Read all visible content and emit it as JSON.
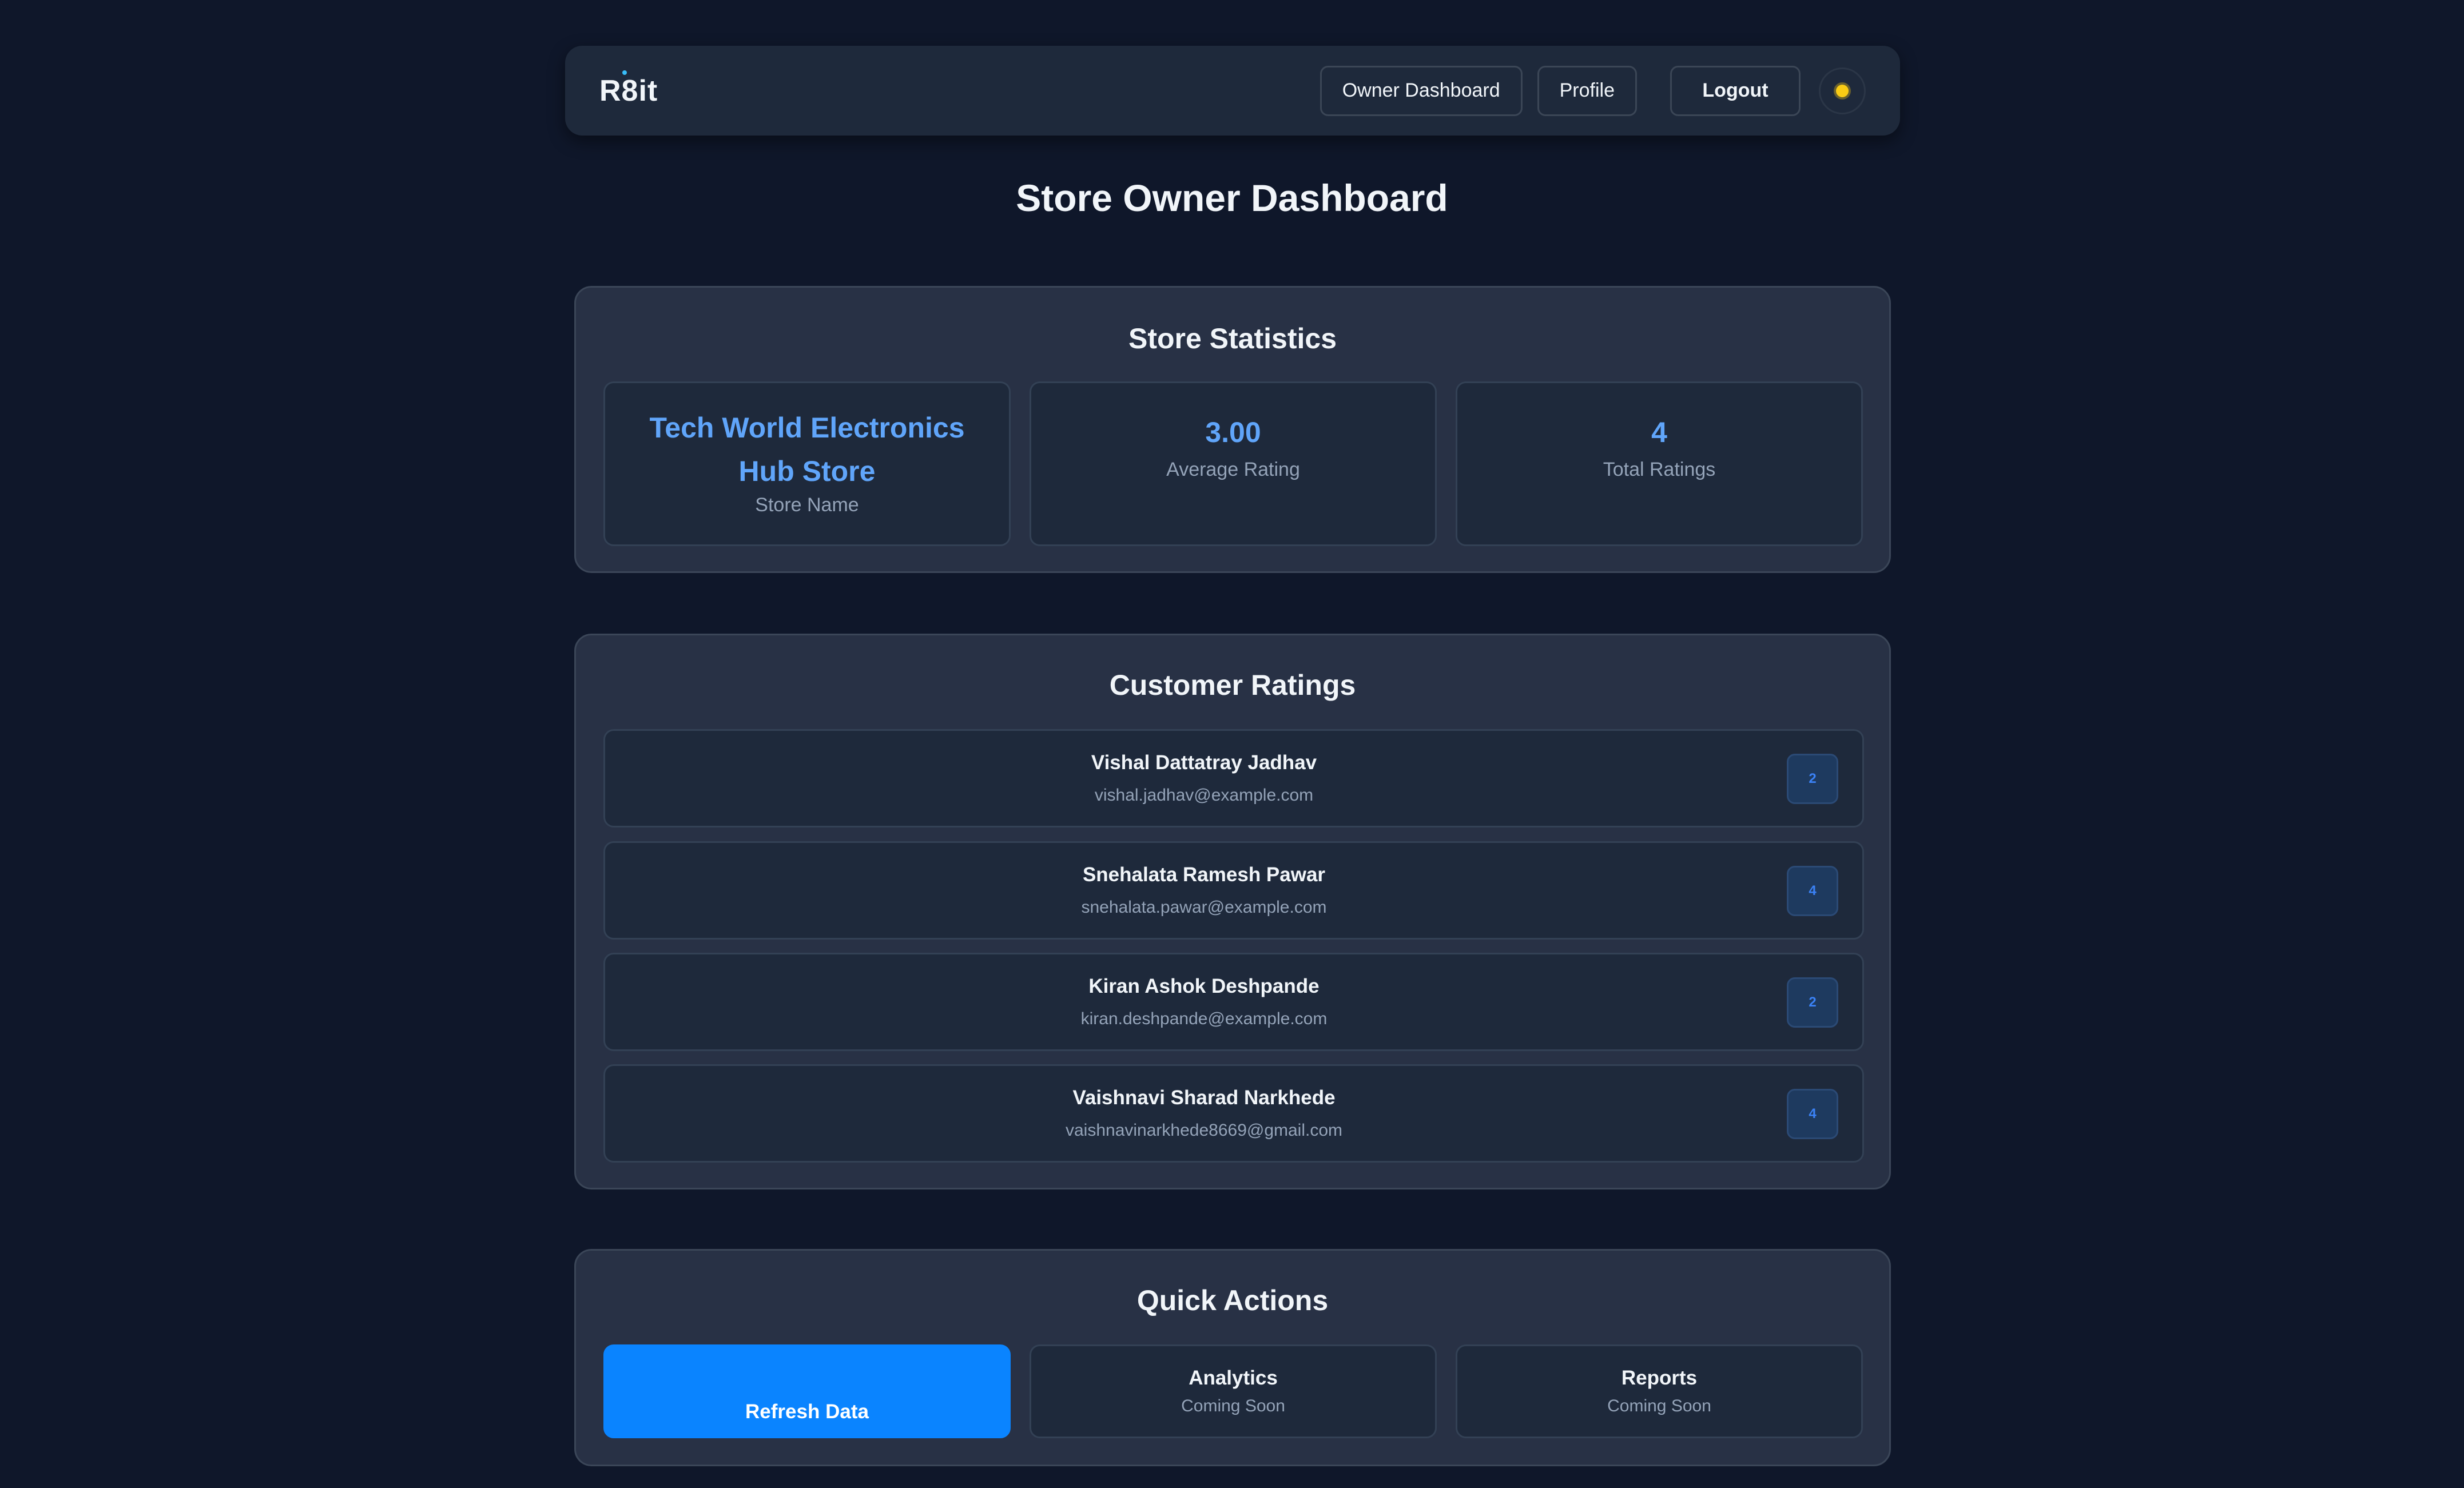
{
  "navbar": {
    "logo": "R8it",
    "links": [
      "Owner Dashboard",
      "Profile"
    ],
    "logout_label": "Logout"
  },
  "page_title": "Store Owner Dashboard",
  "statistics": {
    "title": "Store Statistics",
    "items": [
      {
        "value": "Tech World Electronics Hub Store",
        "label": "Store Name"
      },
      {
        "value": "3.00",
        "label": "Average Rating"
      },
      {
        "value": "4",
        "label": "Total Ratings"
      }
    ]
  },
  "ratings": {
    "title": "Customer Ratings",
    "items": [
      {
        "name": "Vishal Dattatray Jadhav",
        "email": "vishal.jadhav@example.com",
        "rating": "2"
      },
      {
        "name": "Snehalata Ramesh Pawar",
        "email": "snehalata.pawar@example.com",
        "rating": "4"
      },
      {
        "name": "Kiran Ashok Deshpande",
        "email": "kiran.deshpande@example.com",
        "rating": "2"
      },
      {
        "name": "Vaishnavi Sharad Narkhede",
        "email": "vaishnavinarkhede8669@gmail.com",
        "rating": "4"
      }
    ]
  },
  "quick_actions": {
    "title": "Quick Actions",
    "items": [
      {
        "title": "Refresh Data",
        "subtitle": ""
      },
      {
        "title": "Analytics",
        "subtitle": "Coming Soon"
      },
      {
        "title": "Reports",
        "subtitle": "Coming Soon"
      }
    ]
  },
  "colors": {
    "background": "#0f172a",
    "card": "#283145",
    "accent": "#60a5fa",
    "primary_button": "#0a84ff",
    "theme_toggle": "#facc15"
  }
}
